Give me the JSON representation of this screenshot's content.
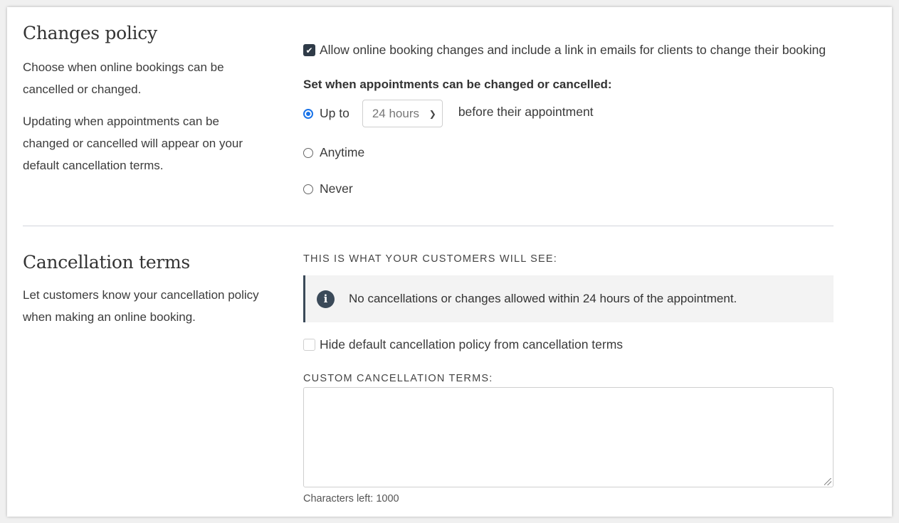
{
  "changes_policy": {
    "title": "Changes policy",
    "desc1": "Choose when online bookings can be cancelled or changed.",
    "desc2": "Updating when appointments can be changed or cancelled will appear on your default cancellation terms.",
    "allow_checkbox_label": "Allow online booking changes and include a link in emails for clients to change their booking",
    "allow_checked": true,
    "set_when_label": "Set when appointments can be changed or cancelled:",
    "options": {
      "up_to": "Up to",
      "select_value": "24 hours",
      "before_text": "before their appointment",
      "anytime": "Anytime",
      "never": "Never"
    },
    "selected_option": "up_to"
  },
  "cancellation_terms": {
    "title": "Cancellation terms",
    "desc": "Let customers know your cancellation policy when making an online booking.",
    "preview_label": "THIS IS WHAT YOUR CUSTOMERS WILL SEE:",
    "info_text": "No cancellations or changes allowed within 24 hours of the appointment.",
    "info_icon": "info-icon",
    "hide_default_label": "Hide default cancellation policy from cancellation terms",
    "hide_default_checked": false,
    "custom_terms_label": "CUSTOM CANCELLATION TERMS:",
    "custom_terms_value": "",
    "chars_left": "Characters left: 1000"
  },
  "colors": {
    "accent_dark": "#2f3b48",
    "radio_blue": "#1a73e8",
    "info_bg": "#f3f3f3"
  }
}
